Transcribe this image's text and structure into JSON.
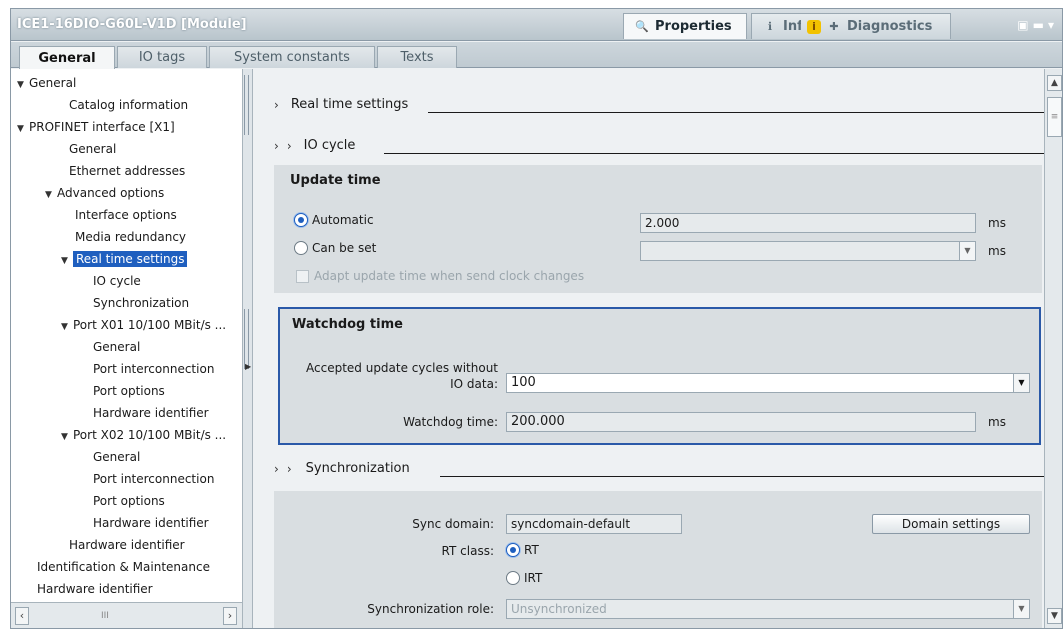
{
  "window": {
    "title": "ICE1-16DIO-G60L-V1D [Module]",
    "panel_tabs": [
      {
        "label": "Properties",
        "icon": "properties-icon"
      },
      {
        "label": "Info",
        "icon": "info-icon"
      },
      {
        "label": "Diagnostics",
        "icon": "diagnostics-icon"
      }
    ]
  },
  "tabs": [
    "General",
    "IO tags",
    "System constants",
    "Texts"
  ],
  "tree": {
    "items": [
      {
        "label": "General",
        "expanded": true
      },
      {
        "label": "Catalog information"
      },
      {
        "label": "PROFINET interface [X1]",
        "expanded": true
      },
      {
        "label": "General"
      },
      {
        "label": "Ethernet addresses"
      },
      {
        "label": "Advanced options",
        "expanded": true
      },
      {
        "label": "Interface options"
      },
      {
        "label": "Media redundancy"
      },
      {
        "label": "Real time settings",
        "expanded": true,
        "selected": true
      },
      {
        "label": "IO cycle"
      },
      {
        "label": "Synchronization"
      },
      {
        "label": "Port X01 10/100 MBit/s ...",
        "expanded": true
      },
      {
        "label": "General"
      },
      {
        "label": "Port interconnection"
      },
      {
        "label": "Port options"
      },
      {
        "label": "Hardware identifier"
      },
      {
        "label": "Port X02 10/100 MBit/s ...",
        "expanded": true
      },
      {
        "label": "General"
      },
      {
        "label": "Port interconnection"
      },
      {
        "label": "Port options"
      },
      {
        "label": "Hardware identifier"
      },
      {
        "label": "Hardware identifier"
      },
      {
        "label": "Identification & Maintenance"
      },
      {
        "label": "Hardware identifier"
      }
    ],
    "scroll_thumb": "III"
  },
  "main": {
    "realtime_heading": "Real time settings",
    "io_cycle_heading": "IO cycle",
    "update_time": {
      "title": "Update time",
      "automatic_label": "Automatic",
      "automatic_value": "2.000",
      "automatic_unit": "ms",
      "can_be_set_label": "Can be set",
      "can_be_set_value": "",
      "can_be_set_unit": "ms",
      "selected": "Automatic",
      "adapt_label": "Adapt update time when send clock changes"
    },
    "watchdog": {
      "title": "Watchdog time",
      "cycles_label_1": "Accepted update cycles without",
      "cycles_label_2": "IO data:",
      "cycles_value": "100",
      "time_label": "Watchdog time:",
      "time_value": "200.000",
      "time_unit": "ms"
    },
    "synchronization_heading": "Synchronization",
    "sync": {
      "domain_label": "Sync domain:",
      "domain_value": "syncdomain-default",
      "domain_button": "Domain settings",
      "rt_class_label": "RT class:",
      "rt_option": "RT",
      "irt_option": "IRT",
      "selected": "RT",
      "role_label": "Synchronization role:",
      "role_value": "Unsynchronized"
    }
  }
}
